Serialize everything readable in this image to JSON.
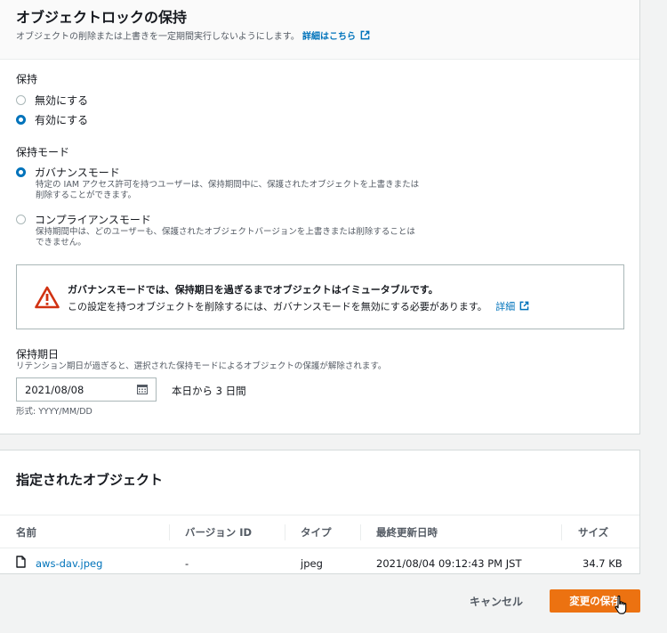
{
  "header": {
    "title": "オブジェクトロックの保持",
    "description": "オブジェクトの削除または上書きを一定期間実行しないようにします。",
    "learn_more": "詳細はこちら"
  },
  "retention": {
    "label": "保持",
    "options": [
      "無効にする",
      "有効にする"
    ],
    "selected": "有効にする"
  },
  "mode": {
    "label": "保持モード",
    "selected": "ガバナンスモード",
    "governance": {
      "label": "ガバナンスモード",
      "desc1": "特定の IAM アクセス許可を持つユーザーは、保持期間中に、保護されたオブジェクトを上書きまたは",
      "desc2": "削除することができます。"
    },
    "compliance": {
      "label": "コンプライアンスモード",
      "desc1": "保持期間中は、どのユーザーも、保護されたオブジェクトバージョンを上書きまたは削除することは",
      "desc2": "できません。"
    }
  },
  "warning": {
    "title": "ガバナンスモードでは、保持期日を過ぎるまでオブジェクトはイミュータブルです。",
    "body": "この設定を持つオブジェクトを削除するには、ガバナンスモードを無効にする必要があります。",
    "link": "詳細"
  },
  "retain_until": {
    "label": "保持期日",
    "desc": "リテンション期日が過ぎると、選択された保持モードによるオブジェクトの保護が解除されます。",
    "value": "2021/08/08",
    "days_note": "本日から 3 日間",
    "format": "形式: YYYY/MM/DD"
  },
  "objects": {
    "title": "指定されたオブジェクト",
    "columns": [
      "名前",
      "バージョン ID",
      "タイプ",
      "最終更新日時",
      "サイズ"
    ],
    "rows": [
      {
        "name": "aws-dav.jpeg",
        "version": "-",
        "type": "jpeg",
        "modified": "2021/08/04 09:12:43 PM JST",
        "size": "34.7 KB"
      }
    ]
  },
  "footer": {
    "cancel": "キャンセル",
    "save": "変更の保存"
  },
  "colors": {
    "accent": "#0073bb",
    "primary_button": "#ec7211",
    "warning_icon": "#d13212"
  }
}
